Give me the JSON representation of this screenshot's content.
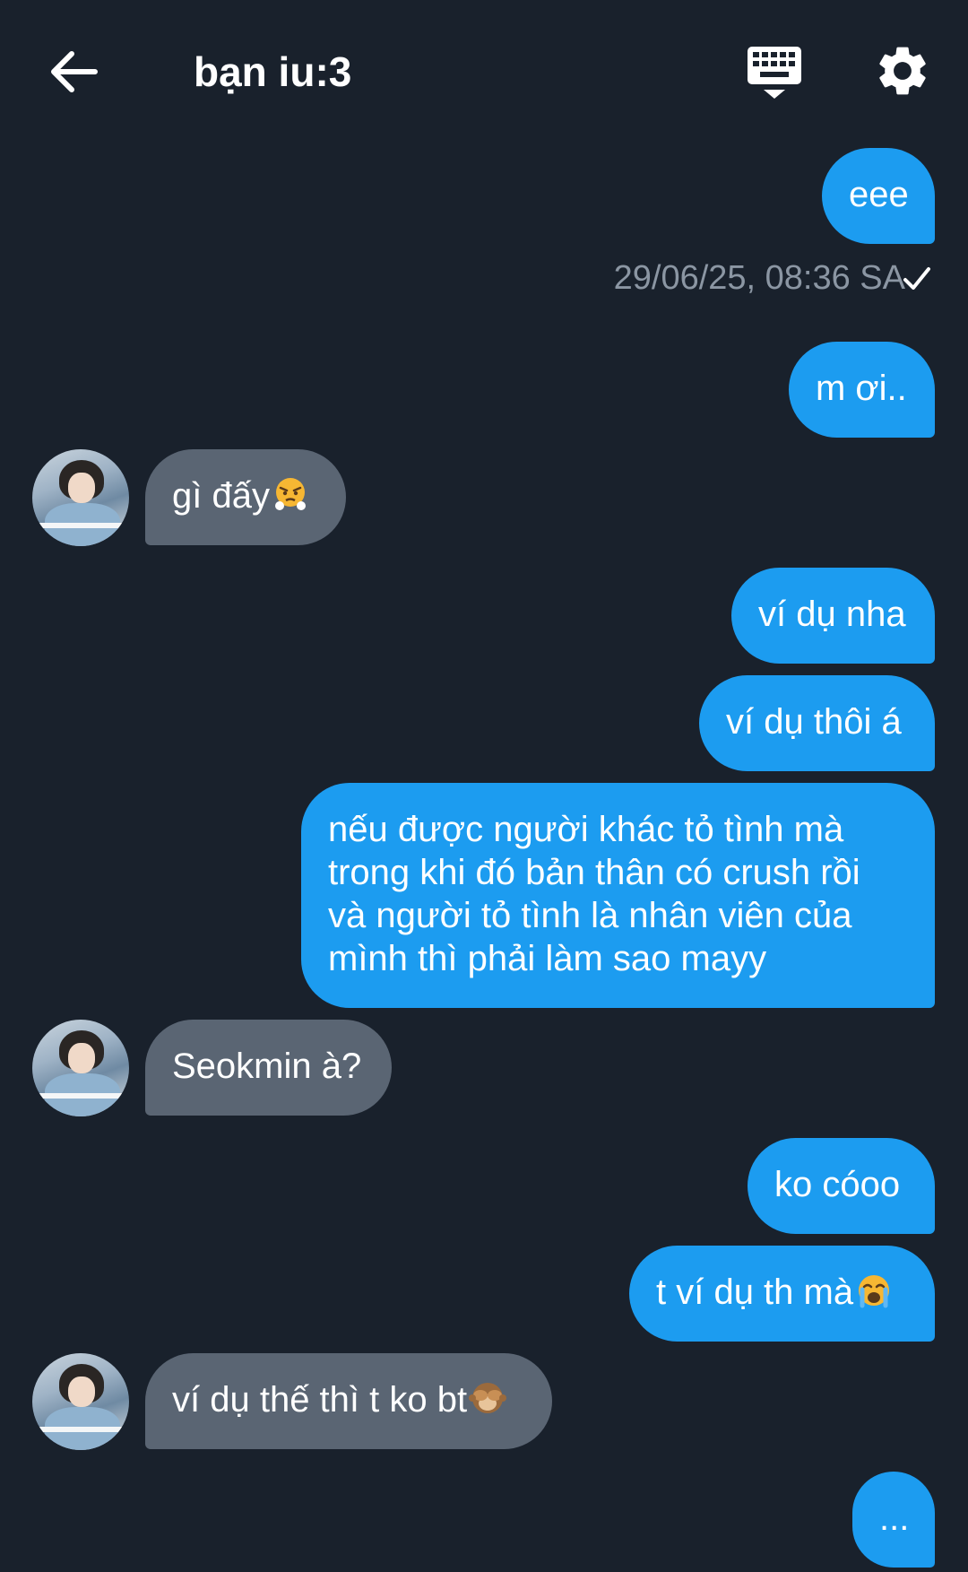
{
  "header": {
    "title": "bạn iu:3",
    "back_icon": "arrow-left-icon",
    "keyboard_icon": "keyboard-icon",
    "settings_icon": "gear-icon"
  },
  "colors": {
    "background": "#19212c",
    "sent_bubble": "#1c9cf0",
    "received_bubble": "#5a6573",
    "timestamp_text": "#8b96a3"
  },
  "messages": [
    {
      "side": "sent",
      "text": "eee"
    },
    {
      "side": "meta",
      "text": "29/06/25, 08:36 SA",
      "status_icon": "check-icon"
    },
    {
      "side": "sent",
      "text": "m ơi.."
    },
    {
      "side": "received",
      "text": "gì đấy",
      "emoji": "huffing-face-emoji"
    },
    {
      "side": "sent",
      "text": "ví dụ nha"
    },
    {
      "side": "sent",
      "text": "ví dụ thôi á"
    },
    {
      "side": "sent",
      "lines": [
        "nếu được người khác tỏ tình mà",
        "trong khi đó bản thân có crush rồi",
        "và người tỏ tình là nhân viên của",
        "mình thì phải làm sao mayy"
      ]
    },
    {
      "side": "received",
      "text": "Seokmin à?"
    },
    {
      "side": "sent",
      "text": "ko cóoo"
    },
    {
      "side": "sent",
      "text": "t ví dụ th mà",
      "emoji": "loudly-crying-face-emoji"
    },
    {
      "side": "received",
      "text": "ví dụ thế thì t ko bt",
      "emoji": "see-no-evil-monkey-emoji"
    },
    {
      "side": "sent",
      "text": "..."
    }
  ]
}
